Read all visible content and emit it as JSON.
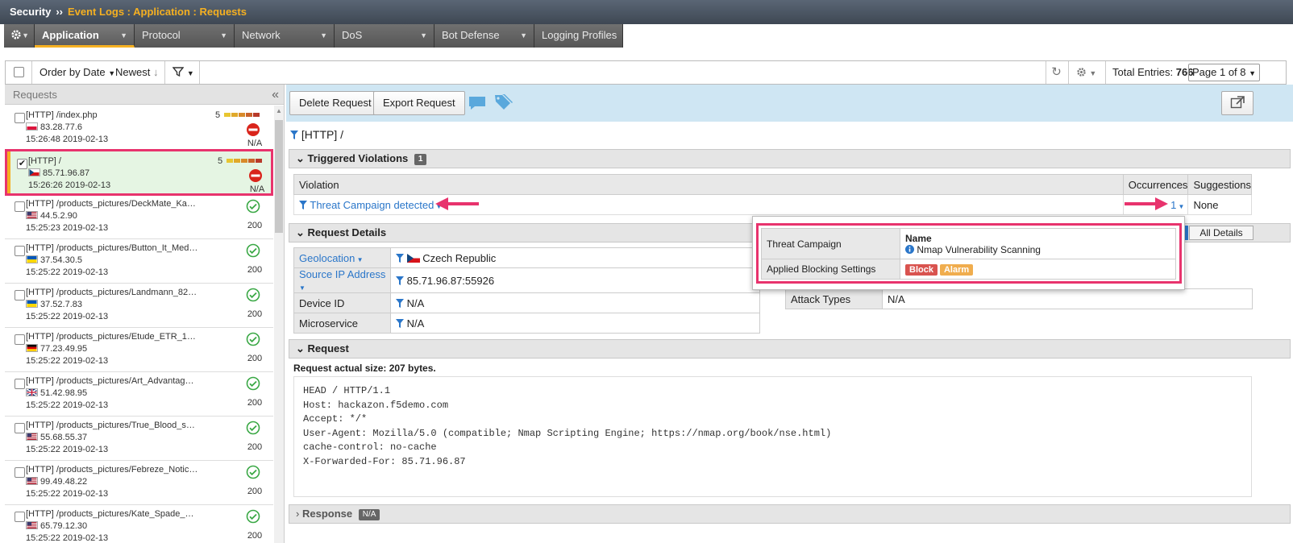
{
  "breadcrumb": {
    "root": "Security",
    "sep": "››",
    "path": "Event Logs : Application : Requests"
  },
  "tabs": [
    {
      "label": "Application",
      "active": true
    },
    {
      "label": "Protocol"
    },
    {
      "label": "Network"
    },
    {
      "label": "DoS"
    },
    {
      "label": "Bot Defense"
    },
    {
      "label": "Logging Profiles"
    }
  ],
  "toolbar": {
    "order_label": "Order by Date",
    "sort_label": "Newest",
    "total_label": "Total Entries:",
    "total_value": "766",
    "page_label": "Page 1 of 8"
  },
  "left": {
    "title": "Requests",
    "items": [
      {
        "url": "[HTTP] /index.php",
        "ip": "83.28.77.6",
        "time": "15:26:48 2019-02-13",
        "score": "5",
        "code": "N/A",
        "status": "blocked"
      },
      {
        "url": "[HTTP] /",
        "ip": "85.71.96.87",
        "time": "15:26:26 2019-02-13",
        "score": "5",
        "code": "N/A",
        "status": "blocked",
        "selected": true
      },
      {
        "url": "[HTTP] /products_pictures/DeckMate_Ka…",
        "ip": "44.5.2.90",
        "time": "15:25:23 2019-02-13",
        "code": "200",
        "status": "ok"
      },
      {
        "url": "[HTTP] /products_pictures/Button_It_Med…",
        "ip": "37.54.30.5",
        "time": "15:25:22 2019-02-13",
        "code": "200",
        "status": "ok"
      },
      {
        "url": "[HTTP] /products_pictures/Landmann_82…",
        "ip": "37.52.7.83",
        "time": "15:25:22 2019-02-13",
        "code": "200",
        "status": "ok"
      },
      {
        "url": "[HTTP] /products_pictures/Etude_ETR_1…",
        "ip": "77.23.49.95",
        "time": "15:25:22 2019-02-13",
        "code": "200",
        "status": "ok"
      },
      {
        "url": "[HTTP] /products_pictures/Art_Advantag…",
        "ip": "51.42.98.95",
        "time": "15:25:22 2019-02-13",
        "code": "200",
        "status": "ok"
      },
      {
        "url": "[HTTP] /products_pictures/True_Blood_s…",
        "ip": "55.68.55.37",
        "time": "15:25:22 2019-02-13",
        "code": "200",
        "status": "ok"
      },
      {
        "url": "[HTTP] /products_pictures/Febreze_Notic…",
        "ip": "99.49.48.22",
        "time": "15:25:22 2019-02-13",
        "code": "200",
        "status": "ok"
      },
      {
        "url": "[HTTP] /products_pictures/Kate_Spade_…",
        "ip": "65.79.12.30",
        "time": "15:25:22 2019-02-13",
        "code": "200",
        "status": "ok"
      }
    ]
  },
  "actions": {
    "delete_label": "Delete Request",
    "export_label": "Export Request"
  },
  "detail": {
    "title": "[HTTP] /",
    "violations_header": "Triggered Violations",
    "violations_count": "1",
    "col_violation": "Violation",
    "col_occurrences": "Occurrences",
    "col_suggestions": "Suggestions",
    "violation_name": "Threat Campaign detected",
    "violation_occ": "1",
    "violation_sugg": "None",
    "request_details_header": "Request Details",
    "all_details": "All Details",
    "geo_label": "Geolocation",
    "geo_value": "Czech Republic",
    "srcip_label": "Source IP Address",
    "srcip_value": "85.71.96.87:55926",
    "device_label": "Device ID",
    "device_value": "N/A",
    "micro_label": "Microservice",
    "micro_value": "N/A",
    "attack_label": "Attack Types",
    "attack_value": "N/A",
    "request_header": "Request",
    "request_size": "Request actual size: 207 bytes.",
    "request_lines": [
      "HEAD / HTTP/1.1",
      "Host: hackazon.f5demo.com",
      "Accept: */*",
      "User-Agent: Mozilla/5.0 (compatible; Nmap Scripting Engine; https://nmap.org/book/nse.html)",
      "cache-control: no-cache",
      "X-Forwarded-For: 85.71.96.87"
    ],
    "response_header": "Response",
    "response_badge": "N/A"
  },
  "popup": {
    "tc_label": "Threat Campaign",
    "name_label": "Name",
    "name_value": "Nmap Vulnerability Scanning",
    "blocking_label": "Applied Blocking Settings",
    "block": "Block",
    "alarm": "Alarm"
  },
  "colors": {
    "accent": "#f5b021",
    "highlight": "#e8336d",
    "link": "#2a76c9",
    "block": "#d9534f",
    "alarm": "#f0ad4e",
    "ok": "#3aa845"
  }
}
